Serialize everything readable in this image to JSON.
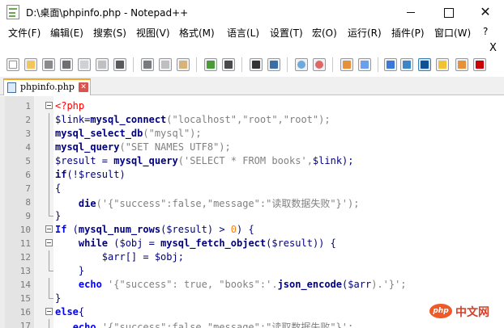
{
  "window": {
    "title": "D:\\桌面\\phpinfo.php - Notepad++",
    "min_glyph": "",
    "max_glyph": "",
    "close_glyph": "✕"
  },
  "menu": [
    "文件(F)",
    "编辑(E)",
    "搜索(S)",
    "视图(V)",
    "格式(M)",
    "语言(L)",
    "设置(T)",
    "宏(O)",
    "运行(R)",
    "插件(P)",
    "窗口(W)",
    "?"
  ],
  "doc_close": "X",
  "toolbar_icons": [
    "new-file-icon",
    "open-file-icon",
    "save-icon",
    "save-all-icon",
    "close-icon",
    "close-all-icon",
    "print-icon",
    "cut-icon",
    "copy-icon",
    "paste-icon",
    "undo-icon",
    "redo-icon",
    "find-icon",
    "replace-icon",
    "zoom-in-icon",
    "zoom-out-icon",
    "sync-vertical-icon",
    "sync-horizontal-icon",
    "wrap-icon",
    "show-all-chars-icon",
    "indent-guide-icon",
    "doc-map-icon",
    "function-list-icon",
    "record-macro-icon"
  ],
  "tab": {
    "label": "phpinfo.php",
    "close_glyph": "✕"
  },
  "lines": [
    {
      "n": "1"
    },
    {
      "n": "2"
    },
    {
      "n": "3"
    },
    {
      "n": "4"
    },
    {
      "n": "5"
    },
    {
      "n": "6"
    },
    {
      "n": "7"
    },
    {
      "n": "8"
    },
    {
      "n": "9"
    },
    {
      "n": "10"
    },
    {
      "n": "11"
    },
    {
      "n": "12"
    },
    {
      "n": "13"
    },
    {
      "n": "14"
    },
    {
      "n": "15"
    },
    {
      "n": "16"
    },
    {
      "n": "17"
    }
  ],
  "code": {
    "l1_tag": "<?php",
    "l2_var": "$link",
    "l2_eq": "=",
    "l2_fn": "mysql_connect",
    "l2_args": "(\"localhost\",\"root\",\"root\");",
    "l3_fn": "mysql_select_db",
    "l3_args": "(\"mysql\");",
    "l4_fn": "mysql_query",
    "l4_args": "(\"SET NAMES UTF8\");",
    "l5_var": "$result",
    "l5_eq": " = ",
    "l5_fn": "mysql_query",
    "l5_str": "('SELECT * FROM books',",
    "l5_var2": "$link",
    "l5_end": ");",
    "l6_kw": "if",
    "l6_rest": "(!",
    "l6_var": "$result",
    "l6_end": ")",
    "l7": "{",
    "l8_fn": "die",
    "l8_str": "('{\"success\":false,\"message\":\"读取数据失败\"}');",
    "l9": "}",
    "l10_kw": "If",
    "l10_open": " (",
    "l10_fn": "mysql_num_rows",
    "l10_a": "(",
    "l10_var": "$result",
    "l10_b": ") > ",
    "l10_num": "0",
    "l10_c": ") {",
    "l11_kw": "while",
    "l11_a": " (",
    "l11_var": "$obj",
    "l11_b": " = ",
    "l11_fn": "mysql_fetch_object",
    "l11_c": "(",
    "l11_var2": "$result",
    "l11_d": ")) {",
    "l12_var": "$arr",
    "l12_a": "[] = ",
    "l12_var2": "$obj",
    "l12_b": ";",
    "l13": "}",
    "l14_kw": "echo",
    "l14_str": " '{\"success\": true, \"books\":'.",
    "l14_fn": "json_encode",
    "l14_a": "(",
    "l14_var": "$arr",
    "l14_b": ").'}';",
    "l15": "}",
    "l16_kw": "else",
    "l16_b": "{",
    "l17_kw": "echo",
    "l17_str": " '{\"success\":false,\"message\":\"读取数据失败\"}';"
  },
  "watermark": {
    "logo": "php",
    "text": "中文网"
  },
  "colors": {
    "keyword": "#0000ff",
    "function": "#000080",
    "string": "#808080",
    "php_tag": "#ff0000",
    "number": "#ff8000",
    "tab_accent": "#f5a623"
  }
}
